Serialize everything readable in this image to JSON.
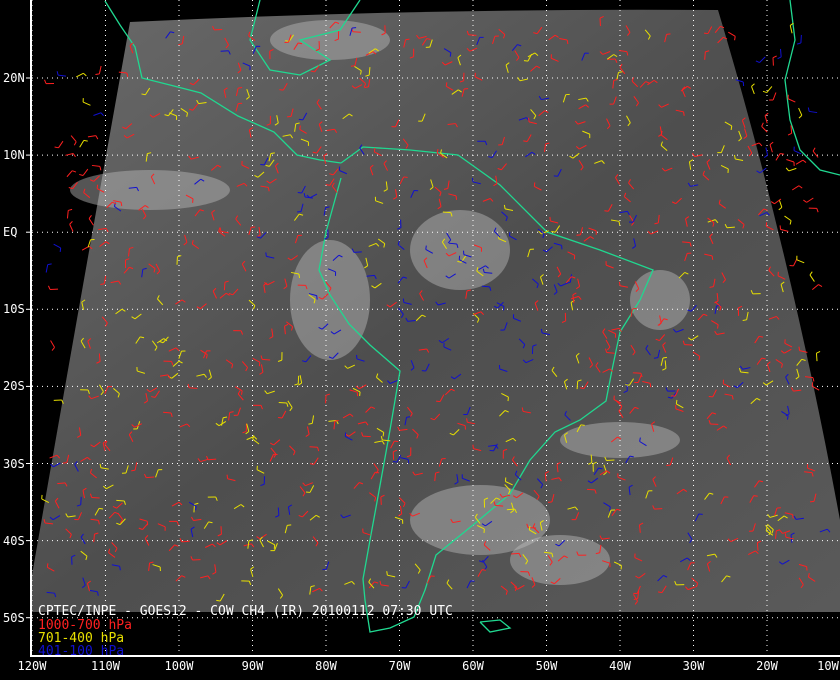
{
  "title": "CPTEC/INPE - GOES12 - COW CH4 (IR) 20100112 07:30 UTC",
  "legend": [
    {
      "label": "1000-700 hPa",
      "color": "#ff2020"
    },
    {
      "label": "701-400 hPa",
      "color": "#e8e000"
    },
    {
      "label": "401-100 hPa",
      "color": "#1010d0"
    }
  ],
  "lat_labels": [
    "20N",
    "10N",
    "EQ",
    "10S",
    "20S",
    "30S",
    "40S",
    "50S"
  ],
  "lon_labels": [
    "120W",
    "110W",
    "100W",
    "90W",
    "80W",
    "70W",
    "60W",
    "50W",
    "40W",
    "30W",
    "20W",
    "10W"
  ],
  "colors": {
    "coastline": "#20d890",
    "grid": "#ffffff",
    "background": "#000000"
  }
}
